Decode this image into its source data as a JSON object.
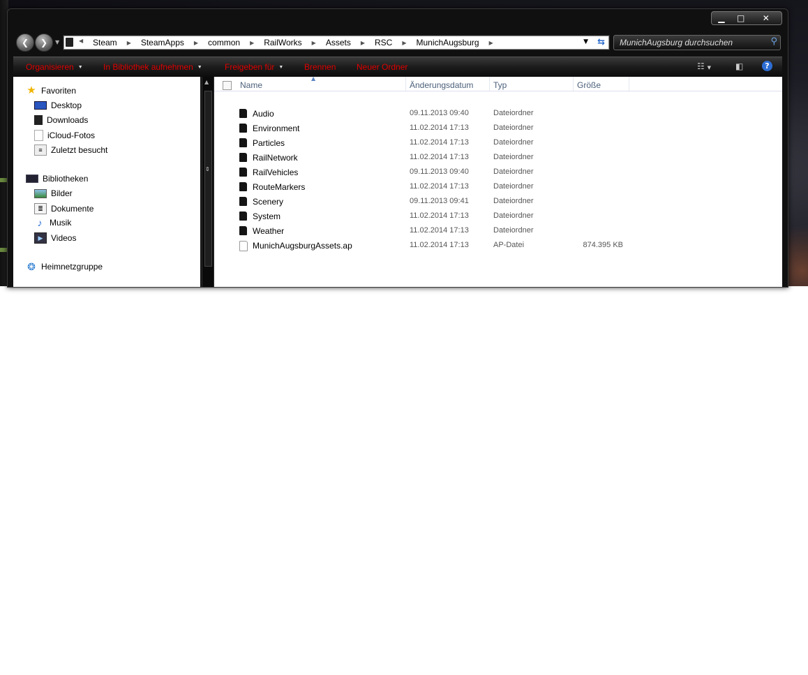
{
  "window": {
    "controls": {
      "minimize": "▁",
      "maximize": "□",
      "close": "✕"
    }
  },
  "nav": {
    "back": "❮",
    "forward": "❯"
  },
  "address": {
    "crumbs": [
      "Steam",
      "SteamApps",
      "common",
      "RailWorks",
      "Assets",
      "RSC",
      "MunichAugsburg"
    ]
  },
  "search": {
    "placeholder": "MunichAugsburg durchsuchen"
  },
  "toolbar": {
    "organize": "Organisieren",
    "add_library": "In Bibliothek aufnehmen",
    "share": "Freigeben für",
    "burn": "Brennen",
    "new_folder": "Neuer Ordner",
    "help": "?"
  },
  "sidebar": {
    "favorites": {
      "label": "Favoriten",
      "items": [
        {
          "label": "Desktop",
          "icon": "desktop-icon"
        },
        {
          "label": "Downloads",
          "icon": "downloads-icon"
        },
        {
          "label": "iCloud-Fotos",
          "icon": "document-icon"
        },
        {
          "label": "Zuletzt besucht",
          "icon": "recent-places-icon"
        }
      ]
    },
    "libraries": {
      "label": "Bibliotheken",
      "items": [
        {
          "label": "Bilder",
          "icon": "pictures-icon"
        },
        {
          "label": "Dokumente",
          "icon": "documents-icon"
        },
        {
          "label": "Musik",
          "icon": "music-icon"
        },
        {
          "label": "Videos",
          "icon": "videos-icon"
        }
      ]
    },
    "homegroup": {
      "label": "Heimnetzgruppe"
    }
  },
  "columns": {
    "name": "Name",
    "date": "Änderungsdatum",
    "type": "Typ",
    "size": "Größe"
  },
  "files": [
    {
      "name": "Audio",
      "date": "09.11.2013 09:40",
      "type": "Dateiordner",
      "size": "",
      "kind": "folder"
    },
    {
      "name": "Environment",
      "date": "11.02.2014 17:13",
      "type": "Dateiordner",
      "size": "",
      "kind": "folder"
    },
    {
      "name": "Particles",
      "date": "11.02.2014 17:13",
      "type": "Dateiordner",
      "size": "",
      "kind": "folder"
    },
    {
      "name": "RailNetwork",
      "date": "11.02.2014 17:13",
      "type": "Dateiordner",
      "size": "",
      "kind": "folder"
    },
    {
      "name": "RailVehicles",
      "date": "09.11.2013 09:40",
      "type": "Dateiordner",
      "size": "",
      "kind": "folder"
    },
    {
      "name": "RouteMarkers",
      "date": "11.02.2014 17:13",
      "type": "Dateiordner",
      "size": "",
      "kind": "folder"
    },
    {
      "name": "Scenery",
      "date": "09.11.2013 09:41",
      "type": "Dateiordner",
      "size": "",
      "kind": "folder"
    },
    {
      "name": "System",
      "date": "11.02.2014 17:13",
      "type": "Dateiordner",
      "size": "",
      "kind": "folder"
    },
    {
      "name": "Weather",
      "date": "11.02.2014 17:13",
      "type": "Dateiordner",
      "size": "",
      "kind": "folder"
    },
    {
      "name": "MunichAugsburgAssets.ap",
      "date": "11.02.2014 17:13",
      "type": "AP-Datei",
      "size": "874.395 KB",
      "kind": "file"
    }
  ],
  "colors": {
    "toolbar_text": "#e00000",
    "accent": "#2d6ed4"
  }
}
